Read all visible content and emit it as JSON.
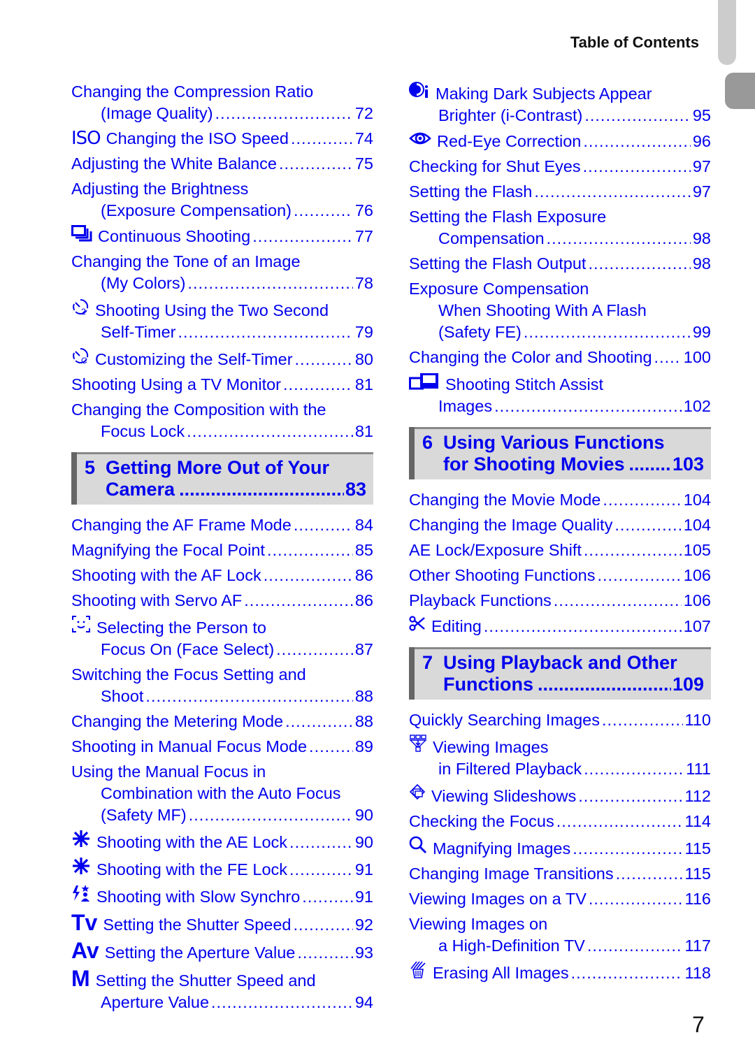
{
  "header": {
    "title": "Table of Contents"
  },
  "page_number": "7",
  "colors": {
    "link": "#0000ee",
    "section_bg": "#d9d9d9",
    "section_bar": "#666666",
    "tab_light": "#cccccc",
    "tab_dark": "#999999"
  },
  "left_column": {
    "entries_top": [
      {
        "icon": null,
        "lines": [
          "Changing the Compression Ratio",
          "(Image Quality)"
        ],
        "page": "72"
      },
      {
        "icon": "iso-icon",
        "icon_text": "ISO",
        "lines": [
          "Changing the ISO Speed"
        ],
        "page": "74"
      },
      {
        "icon": null,
        "lines": [
          "Adjusting the White Balance"
        ],
        "page": "75"
      },
      {
        "icon": null,
        "lines": [
          "Adjusting the Brightness",
          "(Exposure Compensation)"
        ],
        "page": "76"
      },
      {
        "icon": "continuous-shooting-icon",
        "lines": [
          "Continuous Shooting"
        ],
        "page": "77"
      },
      {
        "icon": null,
        "lines": [
          "Changing the Tone of an Image",
          "(My Colors)"
        ],
        "page": "78"
      },
      {
        "icon": "two-second-timer-icon",
        "lines": [
          "Shooting Using the Two Second",
          "Self-Timer"
        ],
        "page": "79"
      },
      {
        "icon": "custom-timer-icon",
        "lines": [
          "Customizing the Self-Timer"
        ],
        "page": "80"
      },
      {
        "icon": null,
        "lines": [
          "Shooting Using a TV Monitor"
        ],
        "page": "81"
      },
      {
        "icon": null,
        "lines": [
          "Changing the Composition with the",
          "Focus Lock"
        ],
        "page": "81"
      }
    ],
    "section5": {
      "number": "5",
      "lines": [
        "Getting More Out of Your",
        "Camera"
      ],
      "page": "83"
    },
    "entries_bottom": [
      {
        "icon": null,
        "lines": [
          "Changing the AF Frame Mode"
        ],
        "page": "84"
      },
      {
        "icon": null,
        "lines": [
          "Magnifying the Focal Point"
        ],
        "page": "85"
      },
      {
        "icon": null,
        "lines": [
          "Shooting with the AF Lock"
        ],
        "page": "86"
      },
      {
        "icon": null,
        "lines": [
          "Shooting with Servo AF"
        ],
        "page": "86"
      },
      {
        "icon": "face-select-icon",
        "lines": [
          "Selecting the Person to",
          "Focus On (Face Select)"
        ],
        "page": "87"
      },
      {
        "icon": null,
        "lines": [
          "Switching the Focus Setting and",
          "Shoot"
        ],
        "page": "88"
      },
      {
        "icon": null,
        "lines": [
          "Changing the Metering Mode"
        ],
        "page": "88"
      },
      {
        "icon": null,
        "lines": [
          "Shooting in Manual Focus Mode"
        ],
        "page": "89"
      },
      {
        "icon": null,
        "lines": [
          "Using the Manual Focus in",
          "Combination with the Auto Focus",
          "(Safety MF)"
        ],
        "page": "90"
      },
      {
        "icon": "ae-lock-icon",
        "lines": [
          "Shooting with the AE Lock"
        ],
        "page": "90"
      },
      {
        "icon": "fe-lock-icon",
        "lines": [
          "Shooting with the FE Lock"
        ],
        "page": "91"
      },
      {
        "icon": "slow-synchro-icon",
        "lines": [
          "Shooting with Slow Synchro"
        ],
        "page": "91"
      },
      {
        "icon": "tv-mode-icon",
        "icon_text": "Tv",
        "lines": [
          "Setting the Shutter Speed"
        ],
        "page": "92"
      },
      {
        "icon": "av-mode-icon",
        "icon_text": "Av",
        "lines": [
          "Setting the Aperture Value"
        ],
        "page": "93"
      },
      {
        "icon": "m-mode-icon",
        "icon_text": "M",
        "lines": [
          "Setting the Shutter Speed and",
          "Aperture Value"
        ],
        "page": "94"
      }
    ]
  },
  "right_column": {
    "entries_top": [
      {
        "icon": "i-contrast-icon",
        "lines": [
          "Making Dark Subjects Appear",
          "Brighter (i-Contrast)"
        ],
        "page": "95"
      },
      {
        "icon": "red-eye-icon",
        "lines": [
          "Red-Eye Correction"
        ],
        "page": "96"
      },
      {
        "icon": null,
        "lines": [
          "Checking for Shut Eyes"
        ],
        "page": "97"
      },
      {
        "icon": null,
        "lines": [
          "Setting the Flash"
        ],
        "page": "97"
      },
      {
        "icon": null,
        "lines": [
          "Setting the Flash Exposure",
          "Compensation"
        ],
        "page": "98"
      },
      {
        "icon": null,
        "lines": [
          "Setting the Flash Output"
        ],
        "page": "98"
      },
      {
        "icon": null,
        "lines": [
          "Exposure Compensation",
          "When Shooting With A Flash",
          "(Safety FE)"
        ],
        "page": "99"
      },
      {
        "icon": null,
        "lines": [
          "Changing the Color and Shooting"
        ],
        "page": "100"
      },
      {
        "icon": "stitch-assist-icon",
        "lines": [
          "Shooting Stitch Assist",
          "Images"
        ],
        "page": "102"
      }
    ],
    "section6": {
      "number": "6",
      "lines": [
        "Using Various Functions",
        "for Shooting Movies"
      ],
      "page": "103"
    },
    "entries_mid": [
      {
        "icon": null,
        "lines": [
          "Changing the Movie Mode"
        ],
        "page": "104"
      },
      {
        "icon": null,
        "lines": [
          "Changing the Image Quality"
        ],
        "page": "104"
      },
      {
        "icon": null,
        "lines": [
          "AE Lock/Exposure Shift"
        ],
        "page": "105"
      },
      {
        "icon": null,
        "lines": [
          "Other Shooting Functions"
        ],
        "page": "106"
      },
      {
        "icon": null,
        "lines": [
          "Playback Functions"
        ],
        "page": "106"
      },
      {
        "icon": "scissors-icon",
        "lines": [
          "Editing"
        ],
        "page": "107"
      }
    ],
    "section7": {
      "number": "7",
      "lines": [
        "Using Playback and Other",
        "Functions"
      ],
      "page": "109"
    },
    "entries_bottom": [
      {
        "icon": null,
        "lines": [
          "Quickly Searching Images"
        ],
        "page": "110"
      },
      {
        "icon": "filtered-playback-icon",
        "lines": [
          "Viewing Images",
          "in Filtered Playback"
        ],
        "page": "111"
      },
      {
        "icon": "slideshow-icon",
        "lines": [
          "Viewing Slideshows"
        ],
        "page": "112"
      },
      {
        "icon": null,
        "lines": [
          "Checking the Focus"
        ],
        "page": "114"
      },
      {
        "icon": "magnify-icon",
        "lines": [
          "Magnifying Images"
        ],
        "page": "115"
      },
      {
        "icon": null,
        "lines": [
          "Changing Image Transitions"
        ],
        "page": "115"
      },
      {
        "icon": null,
        "lines": [
          "Viewing Images on a TV"
        ],
        "page": "116"
      },
      {
        "icon": null,
        "lines": [
          "Viewing Images on",
          "a High-Definition TV"
        ],
        "page": "117"
      },
      {
        "icon": "erase-all-icon",
        "lines": [
          "Erasing All Images"
        ],
        "page": "118"
      }
    ]
  }
}
